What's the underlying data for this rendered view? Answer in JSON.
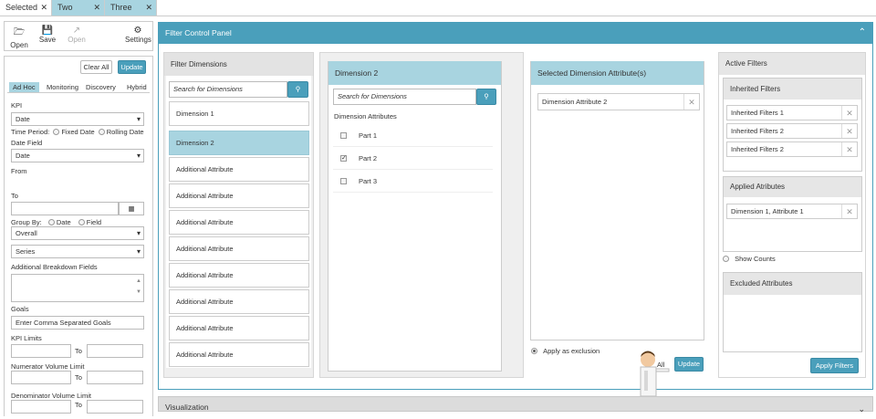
{
  "tabs": [
    {
      "label": "Selected"
    },
    {
      "label": "Two"
    },
    {
      "label": "Three"
    }
  ],
  "toolbar": {
    "open": "Open",
    "save": "Save",
    "open2": "Open",
    "settings": "Settings"
  },
  "left": {
    "clear_all": "Clear All",
    "update": "Update",
    "modes": [
      "Ad Hoc",
      "Monitoring",
      "Discovery",
      "Hybrid"
    ],
    "kpi_label": "KPI",
    "kpi_value": "Date",
    "time_period_label": "Time Period:",
    "fixed_date": "Fixed Date",
    "rolling_date": "Rolling Date",
    "date_field_label": "Date Field",
    "date_field_value": "Date",
    "from_label": "From",
    "to_label": "To",
    "group_by_label": "Group By:",
    "group_date": "Date",
    "group_field": "Field",
    "overall": "Overall",
    "series": "Series",
    "breakdown_label": "Additional Breakdown Fields",
    "goals_label": "Goals",
    "goals_placeholder": "Enter Comma Separated Goals",
    "kpi_limits_label": "KPI Limits",
    "to": "To",
    "num_label": "Numerator Volume Limit",
    "den_label": "Denominator Volume Limit"
  },
  "fcp": {
    "title": "Filter Control Panel"
  },
  "filter_dims": {
    "title": "Filter Dimensions",
    "search_placeholder": "Search for Dimensions",
    "items": [
      "Dimension 1",
      "Dimension 2",
      "Additional Attribute",
      "Additional Attribute",
      "Additional Attribute",
      "Additional Attribute",
      "Additional Attribute",
      "Additional Attribute",
      "Additional Attribute",
      "Additional Attribute"
    ]
  },
  "dim2": {
    "title": "Dimension 2",
    "search_placeholder": "Search for Dimensions",
    "attrs_label": "Dimension Attributes",
    "parts": [
      {
        "label": "Part 1",
        "checked": false
      },
      {
        "label": "Part 2",
        "checked": true
      },
      {
        "label": "Part 3",
        "checked": false
      }
    ]
  },
  "selected": {
    "title": "Selected Dimension Attribute(s)",
    "items": [
      "Dimension Attribute 2"
    ],
    "apply_exclusion": "Apply as exclusion",
    "all_label": "All",
    "update": "Update"
  },
  "active": {
    "title": "Active Filters",
    "inherited_title": "Inherited Filters",
    "inherited": [
      "Inherited Filters 1",
      "Inherited Filters 2",
      "Inherited Filters 2"
    ],
    "applied_title": "Applied Atributes",
    "applied": [
      "Dimension 1, Attribute 1"
    ],
    "show_counts": "Show Counts",
    "excluded_title": "Excluded Attributes",
    "apply_filters": "Apply Filters"
  },
  "viz": {
    "title": "Visualization"
  },
  "colors": {
    "accent": "#4a9fbb",
    "selected_item": "#a8d4e0",
    "tab_inactive": "#a8d4e0"
  }
}
